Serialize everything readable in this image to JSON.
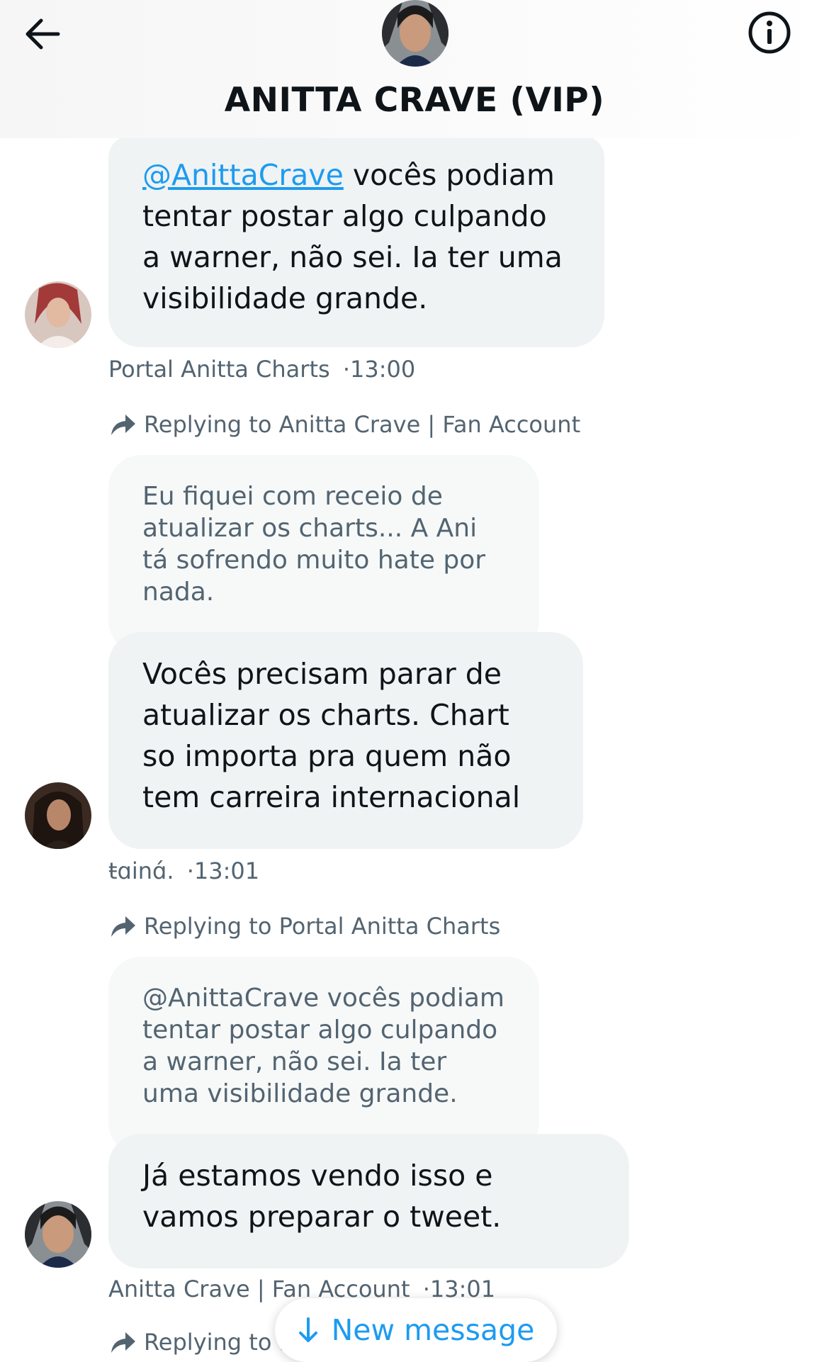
{
  "header": {
    "title": "ANITTA CRAVE (VIP)",
    "back_icon": "arrow-left-icon",
    "info_icon": "info-circle-icon"
  },
  "messages": [
    {
      "mention": "@AnittaCrave",
      "text_rest": " vocês podiam tentar postar algo culpando a warner, não sei. Ia ter uma visibilidade grande.",
      "sender": "Portal Anitta Charts",
      "time": "·13:00"
    },
    {
      "replying_to": "Replying to Anitta Crave | Fan Account",
      "quoted_text": "Eu fiquei com receio de atualizar os charts... A Ani tá sofrendo muito hate por nada.",
      "text": "Vocês precisam parar de atualizar os charts. Chart so importa pra quem não tem carreira internacional",
      "sender": "ŧɑinɑ́.",
      "time": "·13:01"
    },
    {
      "replying_to": "Replying to Portal Anitta Charts",
      "quoted_text": "@AnittaCrave vocês podiam tentar postar algo culpando a warner, não sei. Ia ter uma visibilidade grande.",
      "text": "Já estamos vendo isso e vamos preparar o tweet.",
      "sender": "Anitta Crave | Fan Account",
      "time": "·13:01"
    },
    {
      "replying_to": "Replying to F"
    }
  ],
  "new_message_label": "New message",
  "colors": {
    "accent": "#1d9bf0",
    "bubble": "#eff3f4",
    "muted": "#536471"
  }
}
